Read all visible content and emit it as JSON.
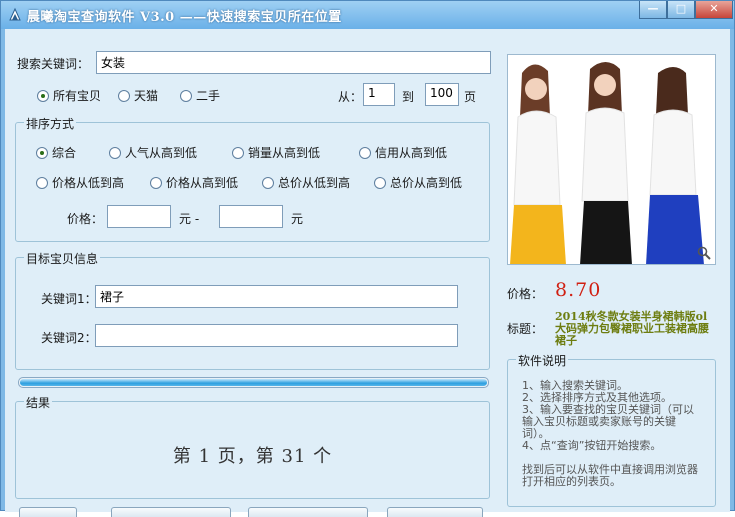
{
  "window": {
    "title": "晨曦淘宝查询软件 V3.0  ——快速搜索宝贝所在位置",
    "minimize": "—",
    "maximize": "□",
    "close": "✕"
  },
  "search": {
    "label": "搜索关键词：",
    "value": "女装"
  },
  "source": {
    "options": [
      "所有宝贝",
      "天猫",
      "二手"
    ],
    "selected": 0
  },
  "pages": {
    "from_label": "从：",
    "from_value": "1",
    "to_label": "到",
    "to_value": "100",
    "unit_label": "页"
  },
  "sort": {
    "group_title": "排序方式",
    "row1": [
      "综合",
      "人气从高到低",
      "销量从高到低",
      "信用从高到低"
    ],
    "row2": [
      "价格从低到高",
      "价格从高到低",
      "总价从低到高",
      "总价从高到低"
    ],
    "selected": "综合",
    "price_label": "价格：",
    "price_unit": "元 -",
    "price_unit2": "元",
    "price_min": "",
    "price_max": ""
  },
  "target": {
    "group_title": "目标宝贝信息",
    "kw1_label": "关键词1：",
    "kw1_value": "裙子",
    "kw2_label": "关键词2：",
    "kw2_value": ""
  },
  "progress": {
    "value": 1.0
  },
  "result": {
    "group_title": "结果",
    "text": "第 1 页，第 31 个"
  },
  "product": {
    "price_label": "价格：",
    "price": "8.70",
    "title_label": "标题：",
    "title": "2014秋冬款女装半身裙韩版ol大码弹力包臀裙职业工装裙高腰裙子",
    "zoom_icon": "magnifier-icon"
  },
  "help": {
    "group_title": "软件说明",
    "lines": [
      "1、输入搜索关键词。",
      "2、选择排序方式及其他选项。",
      "3、输入要查找的宝贝关键词（可以输入宝贝标题或卖家账号的关键词）。",
      "4、点“查询”按钮开始搜索。",
      "",
      "找到后可以从软件中直接调用浏览器打开相应的列表页。"
    ]
  },
  "colors": {
    "title_bar": "#6ab0e8",
    "client_bg": "#dfeef8",
    "price_red": "#d01f12",
    "title_olive": "#6d7d10"
  }
}
